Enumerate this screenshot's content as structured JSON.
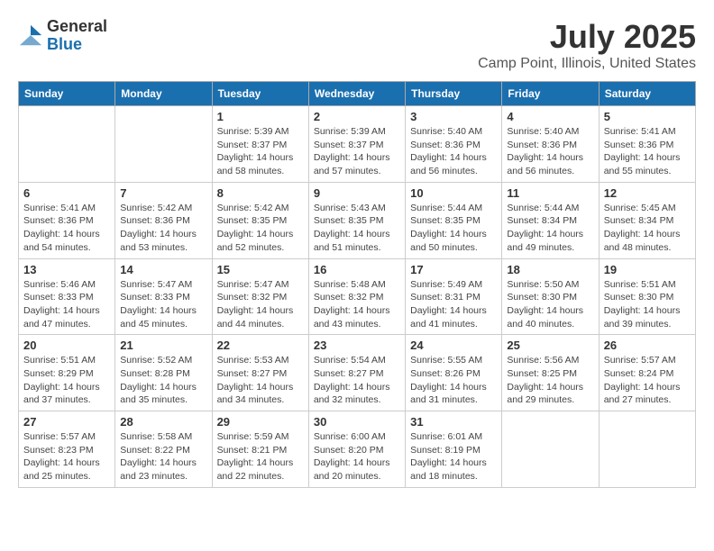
{
  "header": {
    "logo_general": "General",
    "logo_blue": "Blue",
    "month": "July 2025",
    "location": "Camp Point, Illinois, United States"
  },
  "weekdays": [
    "Sunday",
    "Monday",
    "Tuesday",
    "Wednesday",
    "Thursday",
    "Friday",
    "Saturday"
  ],
  "weeks": [
    [
      {
        "day": "",
        "sunrise": "",
        "sunset": "",
        "daylight": ""
      },
      {
        "day": "",
        "sunrise": "",
        "sunset": "",
        "daylight": ""
      },
      {
        "day": "1",
        "sunrise": "Sunrise: 5:39 AM",
        "sunset": "Sunset: 8:37 PM",
        "daylight": "Daylight: 14 hours and 58 minutes."
      },
      {
        "day": "2",
        "sunrise": "Sunrise: 5:39 AM",
        "sunset": "Sunset: 8:37 PM",
        "daylight": "Daylight: 14 hours and 57 minutes."
      },
      {
        "day": "3",
        "sunrise": "Sunrise: 5:40 AM",
        "sunset": "Sunset: 8:36 PM",
        "daylight": "Daylight: 14 hours and 56 minutes."
      },
      {
        "day": "4",
        "sunrise": "Sunrise: 5:40 AM",
        "sunset": "Sunset: 8:36 PM",
        "daylight": "Daylight: 14 hours and 56 minutes."
      },
      {
        "day": "5",
        "sunrise": "Sunrise: 5:41 AM",
        "sunset": "Sunset: 8:36 PM",
        "daylight": "Daylight: 14 hours and 55 minutes."
      }
    ],
    [
      {
        "day": "6",
        "sunrise": "Sunrise: 5:41 AM",
        "sunset": "Sunset: 8:36 PM",
        "daylight": "Daylight: 14 hours and 54 minutes."
      },
      {
        "day": "7",
        "sunrise": "Sunrise: 5:42 AM",
        "sunset": "Sunset: 8:36 PM",
        "daylight": "Daylight: 14 hours and 53 minutes."
      },
      {
        "day": "8",
        "sunrise": "Sunrise: 5:42 AM",
        "sunset": "Sunset: 8:35 PM",
        "daylight": "Daylight: 14 hours and 52 minutes."
      },
      {
        "day": "9",
        "sunrise": "Sunrise: 5:43 AM",
        "sunset": "Sunset: 8:35 PM",
        "daylight": "Daylight: 14 hours and 51 minutes."
      },
      {
        "day": "10",
        "sunrise": "Sunrise: 5:44 AM",
        "sunset": "Sunset: 8:35 PM",
        "daylight": "Daylight: 14 hours and 50 minutes."
      },
      {
        "day": "11",
        "sunrise": "Sunrise: 5:44 AM",
        "sunset": "Sunset: 8:34 PM",
        "daylight": "Daylight: 14 hours and 49 minutes."
      },
      {
        "day": "12",
        "sunrise": "Sunrise: 5:45 AM",
        "sunset": "Sunset: 8:34 PM",
        "daylight": "Daylight: 14 hours and 48 minutes."
      }
    ],
    [
      {
        "day": "13",
        "sunrise": "Sunrise: 5:46 AM",
        "sunset": "Sunset: 8:33 PM",
        "daylight": "Daylight: 14 hours and 47 minutes."
      },
      {
        "day": "14",
        "sunrise": "Sunrise: 5:47 AM",
        "sunset": "Sunset: 8:33 PM",
        "daylight": "Daylight: 14 hours and 45 minutes."
      },
      {
        "day": "15",
        "sunrise": "Sunrise: 5:47 AM",
        "sunset": "Sunset: 8:32 PM",
        "daylight": "Daylight: 14 hours and 44 minutes."
      },
      {
        "day": "16",
        "sunrise": "Sunrise: 5:48 AM",
        "sunset": "Sunset: 8:32 PM",
        "daylight": "Daylight: 14 hours and 43 minutes."
      },
      {
        "day": "17",
        "sunrise": "Sunrise: 5:49 AM",
        "sunset": "Sunset: 8:31 PM",
        "daylight": "Daylight: 14 hours and 41 minutes."
      },
      {
        "day": "18",
        "sunrise": "Sunrise: 5:50 AM",
        "sunset": "Sunset: 8:30 PM",
        "daylight": "Daylight: 14 hours and 40 minutes."
      },
      {
        "day": "19",
        "sunrise": "Sunrise: 5:51 AM",
        "sunset": "Sunset: 8:30 PM",
        "daylight": "Daylight: 14 hours and 39 minutes."
      }
    ],
    [
      {
        "day": "20",
        "sunrise": "Sunrise: 5:51 AM",
        "sunset": "Sunset: 8:29 PM",
        "daylight": "Daylight: 14 hours and 37 minutes."
      },
      {
        "day": "21",
        "sunrise": "Sunrise: 5:52 AM",
        "sunset": "Sunset: 8:28 PM",
        "daylight": "Daylight: 14 hours and 35 minutes."
      },
      {
        "day": "22",
        "sunrise": "Sunrise: 5:53 AM",
        "sunset": "Sunset: 8:27 PM",
        "daylight": "Daylight: 14 hours and 34 minutes."
      },
      {
        "day": "23",
        "sunrise": "Sunrise: 5:54 AM",
        "sunset": "Sunset: 8:27 PM",
        "daylight": "Daylight: 14 hours and 32 minutes."
      },
      {
        "day": "24",
        "sunrise": "Sunrise: 5:55 AM",
        "sunset": "Sunset: 8:26 PM",
        "daylight": "Daylight: 14 hours and 31 minutes."
      },
      {
        "day": "25",
        "sunrise": "Sunrise: 5:56 AM",
        "sunset": "Sunset: 8:25 PM",
        "daylight": "Daylight: 14 hours and 29 minutes."
      },
      {
        "day": "26",
        "sunrise": "Sunrise: 5:57 AM",
        "sunset": "Sunset: 8:24 PM",
        "daylight": "Daylight: 14 hours and 27 minutes."
      }
    ],
    [
      {
        "day": "27",
        "sunrise": "Sunrise: 5:57 AM",
        "sunset": "Sunset: 8:23 PM",
        "daylight": "Daylight: 14 hours and 25 minutes."
      },
      {
        "day": "28",
        "sunrise": "Sunrise: 5:58 AM",
        "sunset": "Sunset: 8:22 PM",
        "daylight": "Daylight: 14 hours and 23 minutes."
      },
      {
        "day": "29",
        "sunrise": "Sunrise: 5:59 AM",
        "sunset": "Sunset: 8:21 PM",
        "daylight": "Daylight: 14 hours and 22 minutes."
      },
      {
        "day": "30",
        "sunrise": "Sunrise: 6:00 AM",
        "sunset": "Sunset: 8:20 PM",
        "daylight": "Daylight: 14 hours and 20 minutes."
      },
      {
        "day": "31",
        "sunrise": "Sunrise: 6:01 AM",
        "sunset": "Sunset: 8:19 PM",
        "daylight": "Daylight: 14 hours and 18 minutes."
      },
      {
        "day": "",
        "sunrise": "",
        "sunset": "",
        "daylight": ""
      },
      {
        "day": "",
        "sunrise": "",
        "sunset": "",
        "daylight": ""
      }
    ]
  ]
}
